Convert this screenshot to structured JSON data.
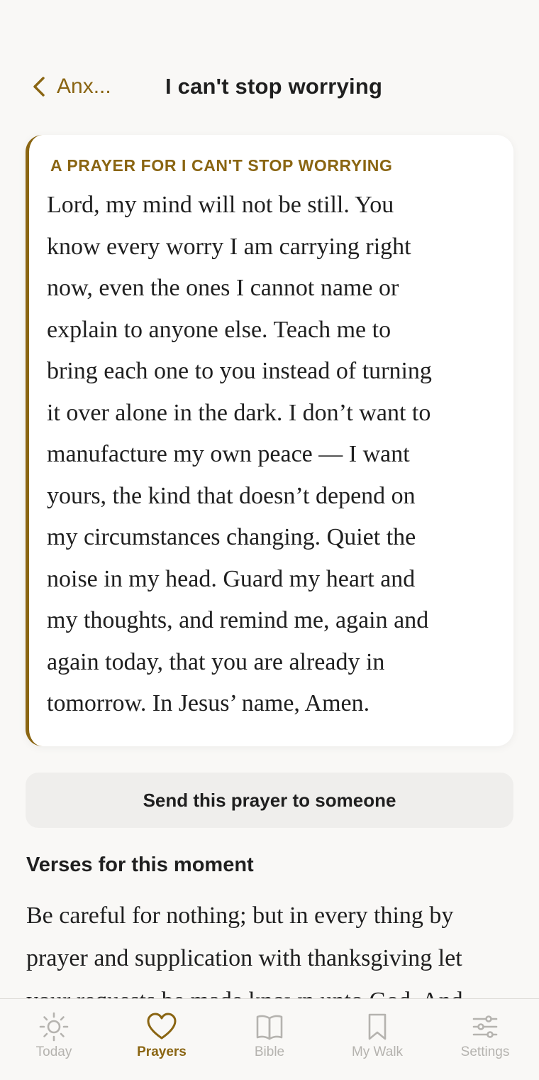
{
  "nav": {
    "back_label": "Anx...",
    "title": "I can't stop worrying"
  },
  "prayer_card": {
    "eyebrow": "A PRAYER FOR I CAN'T STOP WORRYING",
    "lines": [
      "Lord, my mind will not be still. You",
      "know every worry I am carrying right",
      "now, even the ones I cannot name or",
      "explain to anyone else. Teach me to",
      "bring each one to you instead of turning",
      "it over alone in the dark. I don’t want to",
      "manufacture my own peace — I want",
      "yours, the kind that doesn’t depend on",
      "my circumstances changing. Quiet the",
      "noise in my head. Guard my heart and",
      "my thoughts, and remind me, again and",
      "again today, that you are already in",
      "tomorrow. In Jesus’ name, Amen."
    ]
  },
  "send_button_label": "Send this prayer to someone",
  "verses": {
    "heading": "Verses for this moment",
    "lines": [
      "Be careful for nothing; but in every thing by",
      "prayer and supplication with thanksgiving let",
      "your requests be made known unto God. And"
    ]
  },
  "tabbar": {
    "active_color": "#8a6512",
    "inactive_color": "#b5b3af",
    "tabs": [
      {
        "label": "Today",
        "icon": "sun-icon"
      },
      {
        "label": "Prayers",
        "icon": "heart-icon",
        "active": true
      },
      {
        "label": "Bible",
        "icon": "book-icon"
      },
      {
        "label": "My Walk",
        "icon": "bookmark-icon"
      },
      {
        "label": "Settings",
        "icon": "sliders-icon"
      }
    ]
  }
}
